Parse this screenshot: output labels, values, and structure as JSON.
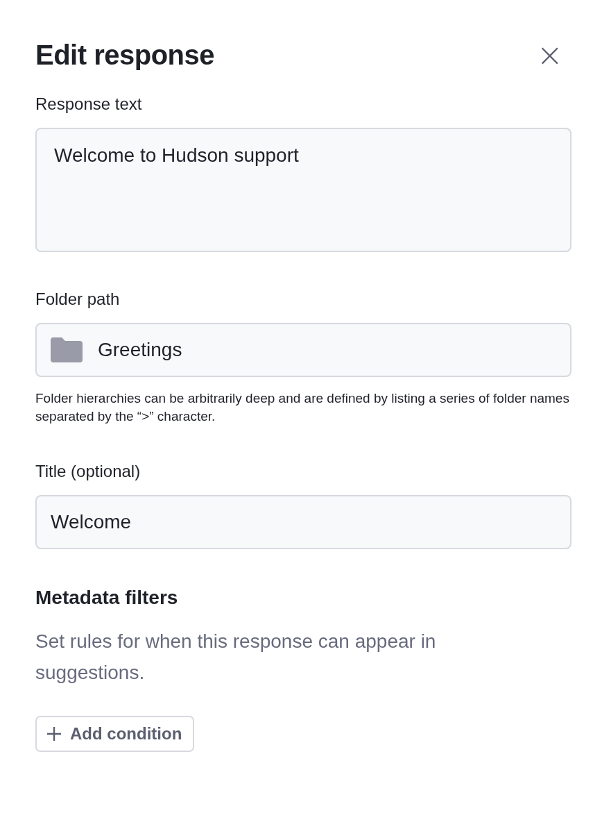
{
  "dialog": {
    "title": "Edit response",
    "close": "×"
  },
  "fields": [
    {
      "kind": "textarea",
      "label": "Response text",
      "value": "Welcome to Hudson support"
    },
    {
      "kind": "folder",
      "label": "Folder path",
      "value": "Greetings",
      "help": "Folder hierarchies can be arbitrarily deep and are defined by listing a series of folder names separated by the “>” character."
    },
    {
      "kind": "text",
      "label": "Title (optional)",
      "value": "Welcome"
    }
  ],
  "metadata": {
    "heading": "Metadata filters",
    "description": "Set rules for when this response can appear in suggestions.",
    "button": "Add condition"
  }
}
